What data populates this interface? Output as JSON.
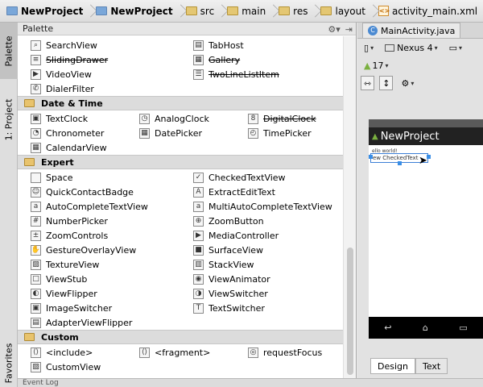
{
  "breadcrumb": [
    {
      "label": "NewProject",
      "icon": "project-icon",
      "bold": true
    },
    {
      "label": "NewProject",
      "icon": "module-icon",
      "bold": true
    },
    {
      "label": "src",
      "icon": "folder-icon",
      "bold": false
    },
    {
      "label": "main",
      "icon": "folder-icon",
      "bold": false
    },
    {
      "label": "res",
      "icon": "folder-icon",
      "bold": false
    },
    {
      "label": "layout",
      "icon": "folder-icon",
      "bold": false
    },
    {
      "label": "activity_main.xml",
      "icon": "xml-file-icon",
      "bold": false
    }
  ],
  "left_strip": {
    "palette_tab": "Palette",
    "project_tab": "1: Project",
    "favorites_tab": "Favorites"
  },
  "palette": {
    "title": "Palette",
    "rows_top": [
      {
        "left": {
          "label": "SearchView",
          "icon": "search-icon"
        },
        "right": {
          "label": "TabHost",
          "icon": "tabhost-icon"
        }
      },
      {
        "left": {
          "label": "SlidingDrawer",
          "icon": "drawer-icon",
          "strike": true
        },
        "right": {
          "label": "Gallery",
          "icon": "gallery-icon",
          "strike": true
        }
      },
      {
        "left": {
          "label": "VideoView",
          "icon": "video-icon"
        },
        "right": {
          "label": "TwoLineListItem",
          "icon": "list-icon",
          "strike": true
        }
      },
      {
        "left": {
          "label": "DialerFilter",
          "icon": "phone-icon"
        }
      }
    ],
    "date_time": {
      "title": "Date & Time",
      "rows": [
        {
          "a": {
            "label": "TextClock",
            "icon": "textclock-icon"
          },
          "b": {
            "label": "AnalogClock",
            "icon": "clock-icon"
          },
          "c": {
            "label": "DigitalClock",
            "icon": "digitalclock-icon",
            "strike": true
          }
        },
        {
          "a": {
            "label": "Chronometer",
            "icon": "chronometer-icon"
          },
          "b": {
            "label": "DatePicker",
            "icon": "datepicker-icon"
          },
          "c": {
            "label": "TimePicker",
            "icon": "timepicker-icon"
          }
        },
        {
          "a": {
            "label": "CalendarView",
            "icon": "calendar-icon"
          }
        }
      ]
    },
    "expert": {
      "title": "Expert",
      "rows": [
        {
          "left": {
            "label": "Space",
            "icon": "space-icon"
          },
          "right": {
            "label": "CheckedTextView",
            "icon": "checkedtext-icon"
          }
        },
        {
          "left": {
            "label": "QuickContactBadge",
            "icon": "contact-icon"
          },
          "right": {
            "label": "ExtractEditText",
            "icon": "edittext-icon"
          }
        },
        {
          "left": {
            "label": "AutoCompleteTextView",
            "icon": "autocomplete-icon"
          },
          "right": {
            "label": "MultiAutoCompleteTextView",
            "icon": "multiautocomplete-icon"
          }
        },
        {
          "left": {
            "label": "NumberPicker",
            "icon": "numberpicker-icon"
          },
          "right": {
            "label": "ZoomButton",
            "icon": "zoom-icon"
          }
        },
        {
          "left": {
            "label": "ZoomControls",
            "icon": "zoomcontrols-icon"
          },
          "right": {
            "label": "MediaController",
            "icon": "play-icon"
          }
        },
        {
          "left": {
            "label": "GestureOverlayView",
            "icon": "gesture-icon"
          },
          "right": {
            "label": "SurfaceView",
            "icon": "surface-icon"
          }
        },
        {
          "left": {
            "label": "TextureView",
            "icon": "texture-icon"
          },
          "right": {
            "label": "StackView",
            "icon": "stack-icon"
          }
        },
        {
          "left": {
            "label": "ViewStub",
            "icon": "viewstub-icon"
          },
          "right": {
            "label": "ViewAnimator",
            "icon": "animator-icon"
          }
        },
        {
          "left": {
            "label": "ViewFlipper",
            "icon": "flipper-icon"
          },
          "right": {
            "label": "ViewSwitcher",
            "icon": "switcher-icon"
          }
        },
        {
          "left": {
            "label": "ImageSwitcher",
            "icon": "imageswitcher-icon"
          },
          "right": {
            "label": "TextSwitcher",
            "icon": "textswitcher-icon"
          }
        },
        {
          "left": {
            "label": "AdapterViewFlipper",
            "icon": "adapterflipper-icon"
          }
        }
      ]
    },
    "custom": {
      "title": "Custom",
      "rows": [
        {
          "a": {
            "label": "<include>",
            "icon": "include-icon"
          },
          "b": {
            "label": "<fragment>",
            "icon": "fragment-icon"
          },
          "c": {
            "label": "requestFocus",
            "icon": "focus-icon"
          }
        },
        {
          "a": {
            "label": "CustomView",
            "icon": "customview-icon"
          }
        }
      ]
    }
  },
  "designer": {
    "editor_tab": "MainActivity.java",
    "device": "Nexus 4",
    "api_level": "17",
    "app_title": "NewProject",
    "hello_text": "ello world!",
    "widget_text": "ew CheckedText",
    "tab_design": "Design",
    "tab_text": "Text"
  },
  "status_text": "Event Log",
  "colors": {
    "selection_blue": "#3a8ee6",
    "action_bar": "#222222",
    "category_bg": "#dcdcdc"
  }
}
